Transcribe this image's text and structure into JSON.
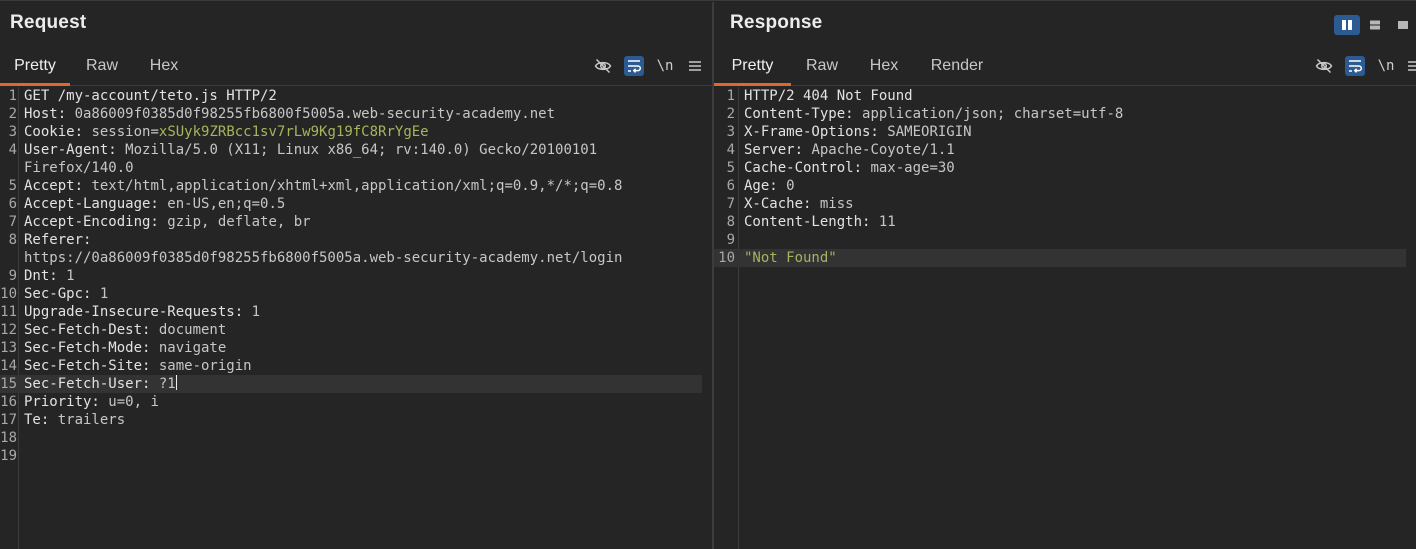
{
  "request": {
    "title": "Request",
    "tabs": [
      "Pretty",
      "Raw",
      "Hex"
    ],
    "active_tab": "Pretty",
    "toolbar": {
      "hide_icon": "eye-off-icon",
      "wrap_icon": "wrap-lines-icon",
      "newline_label": "\\n",
      "menu_icon": "hamburger-menu-icon"
    },
    "lines": [
      {
        "n": "1",
        "parts": [
          {
            "t": "GET /my-account/teto.js HTTP/2",
            "c": "hkey"
          }
        ]
      },
      {
        "n": "2",
        "parts": [
          {
            "t": "Host: ",
            "c": "hkey"
          },
          {
            "t": "0a86009f0385d0f98255fb6800f5005a.web-security-academy.net",
            "c": "hval"
          }
        ]
      },
      {
        "n": "3",
        "parts": [
          {
            "t": "Cookie: ",
            "c": "hkey"
          },
          {
            "t": "session",
            "c": "hval"
          },
          {
            "t": "=",
            "c": "hval"
          },
          {
            "t": "xSUyk9ZRBcc1sv7rLw9Kg19fC8RrYgEe",
            "c": "hcookie"
          }
        ]
      },
      {
        "n": "4",
        "parts": [
          {
            "t": "User-Agent: ",
            "c": "hkey"
          },
          {
            "t": "Mozilla/5.0 (X11; Linux x86_64; rv:140.0) Gecko/20100101",
            "c": "hval"
          }
        ]
      },
      {
        "n": "",
        "parts": [
          {
            "t": "Firefox/140.0",
            "c": "hval"
          }
        ]
      },
      {
        "n": "5",
        "parts": [
          {
            "t": "Accept: ",
            "c": "hkey"
          },
          {
            "t": "text/html,application/xhtml+xml,application/xml;q=0.9,*/*;q=0.8",
            "c": "hval"
          }
        ]
      },
      {
        "n": "6",
        "parts": [
          {
            "t": "Accept-Language: ",
            "c": "hkey"
          },
          {
            "t": "en-US,en;q=0.5",
            "c": "hval"
          }
        ]
      },
      {
        "n": "7",
        "parts": [
          {
            "t": "Accept-Encoding: ",
            "c": "hkey"
          },
          {
            "t": "gzip, deflate, br",
            "c": "hval"
          }
        ]
      },
      {
        "n": "8",
        "parts": [
          {
            "t": "Referer: ",
            "c": "hkey"
          }
        ]
      },
      {
        "n": "",
        "parts": [
          {
            "t": "https://0a86009f0385d0f98255fb6800f5005a.web-security-academy.net/login",
            "c": "hval"
          }
        ]
      },
      {
        "n": "9",
        "parts": [
          {
            "t": "Dnt: ",
            "c": "hkey"
          },
          {
            "t": "1",
            "c": "hval"
          }
        ]
      },
      {
        "n": "10",
        "parts": [
          {
            "t": "Sec-Gpc: ",
            "c": "hkey"
          },
          {
            "t": "1",
            "c": "hval"
          }
        ]
      },
      {
        "n": "11",
        "parts": [
          {
            "t": "Upgrade-Insecure-Requests: ",
            "c": "hkey"
          },
          {
            "t": "1",
            "c": "hval"
          }
        ]
      },
      {
        "n": "12",
        "parts": [
          {
            "t": "Sec-Fetch-Dest: ",
            "c": "hkey"
          },
          {
            "t": "document",
            "c": "hval"
          }
        ]
      },
      {
        "n": "13",
        "parts": [
          {
            "t": "Sec-Fetch-Mode: ",
            "c": "hkey"
          },
          {
            "t": "navigate",
            "c": "hval"
          }
        ]
      },
      {
        "n": "14",
        "parts": [
          {
            "t": "Sec-Fetch-Site: ",
            "c": "hkey"
          },
          {
            "t": "same-origin",
            "c": "hval"
          }
        ]
      },
      {
        "n": "15",
        "highlight": true,
        "cursor": true,
        "parts": [
          {
            "t": "Sec-Fetch-User: ",
            "c": "hkey"
          },
          {
            "t": "?1",
            "c": "hval"
          }
        ]
      },
      {
        "n": "16",
        "parts": [
          {
            "t": "Priority: ",
            "c": "hkey"
          },
          {
            "t": "u=0, i",
            "c": "hval"
          }
        ]
      },
      {
        "n": "17",
        "parts": [
          {
            "t": "Te: ",
            "c": "hkey"
          },
          {
            "t": "trailers",
            "c": "hval"
          }
        ]
      },
      {
        "n": "18",
        "parts": []
      },
      {
        "n": "19",
        "parts": []
      }
    ]
  },
  "response": {
    "title": "Response",
    "tabs": [
      "Pretty",
      "Raw",
      "Hex",
      "Render"
    ],
    "active_tab": "Pretty",
    "layout_toggles": [
      "split-columns-icon",
      "split-rows-icon",
      "single-pane-icon"
    ],
    "toolbar": {
      "hide_icon": "eye-off-icon",
      "wrap_icon": "wrap-lines-icon",
      "newline_label": "\\n",
      "menu_icon": "hamburger-menu-icon"
    },
    "lines": [
      {
        "n": "1",
        "parts": [
          {
            "t": "HTTP/2 404 Not Found",
            "c": "hkey"
          }
        ]
      },
      {
        "n": "2",
        "parts": [
          {
            "t": "Content-Type: ",
            "c": "hkey"
          },
          {
            "t": "application/json; charset=utf-8",
            "c": "hval"
          }
        ]
      },
      {
        "n": "3",
        "parts": [
          {
            "t": "X-Frame-Options: ",
            "c": "hkey"
          },
          {
            "t": "SAMEORIGIN",
            "c": "hval"
          }
        ]
      },
      {
        "n": "4",
        "parts": [
          {
            "t": "Server: ",
            "c": "hkey"
          },
          {
            "t": "Apache-Coyote/1.1",
            "c": "hval"
          }
        ]
      },
      {
        "n": "5",
        "parts": [
          {
            "t": "Cache-Control: ",
            "c": "hkey"
          },
          {
            "t": "max-age=30",
            "c": "hval"
          }
        ]
      },
      {
        "n": "6",
        "parts": [
          {
            "t": "Age: ",
            "c": "hkey"
          },
          {
            "t": "0",
            "c": "hval"
          }
        ]
      },
      {
        "n": "7",
        "parts": [
          {
            "t": "X-Cache: ",
            "c": "hkey"
          },
          {
            "t": "miss",
            "c": "hval"
          }
        ]
      },
      {
        "n": "8",
        "parts": [
          {
            "t": "Content-Length: ",
            "c": "hkey"
          },
          {
            "t": "11",
            "c": "hval"
          }
        ]
      },
      {
        "n": "9",
        "parts": []
      },
      {
        "n": "10",
        "highlight": true,
        "parts": [
          {
            "t": "\"Not Found\"",
            "c": "hstr"
          }
        ]
      }
    ]
  }
}
